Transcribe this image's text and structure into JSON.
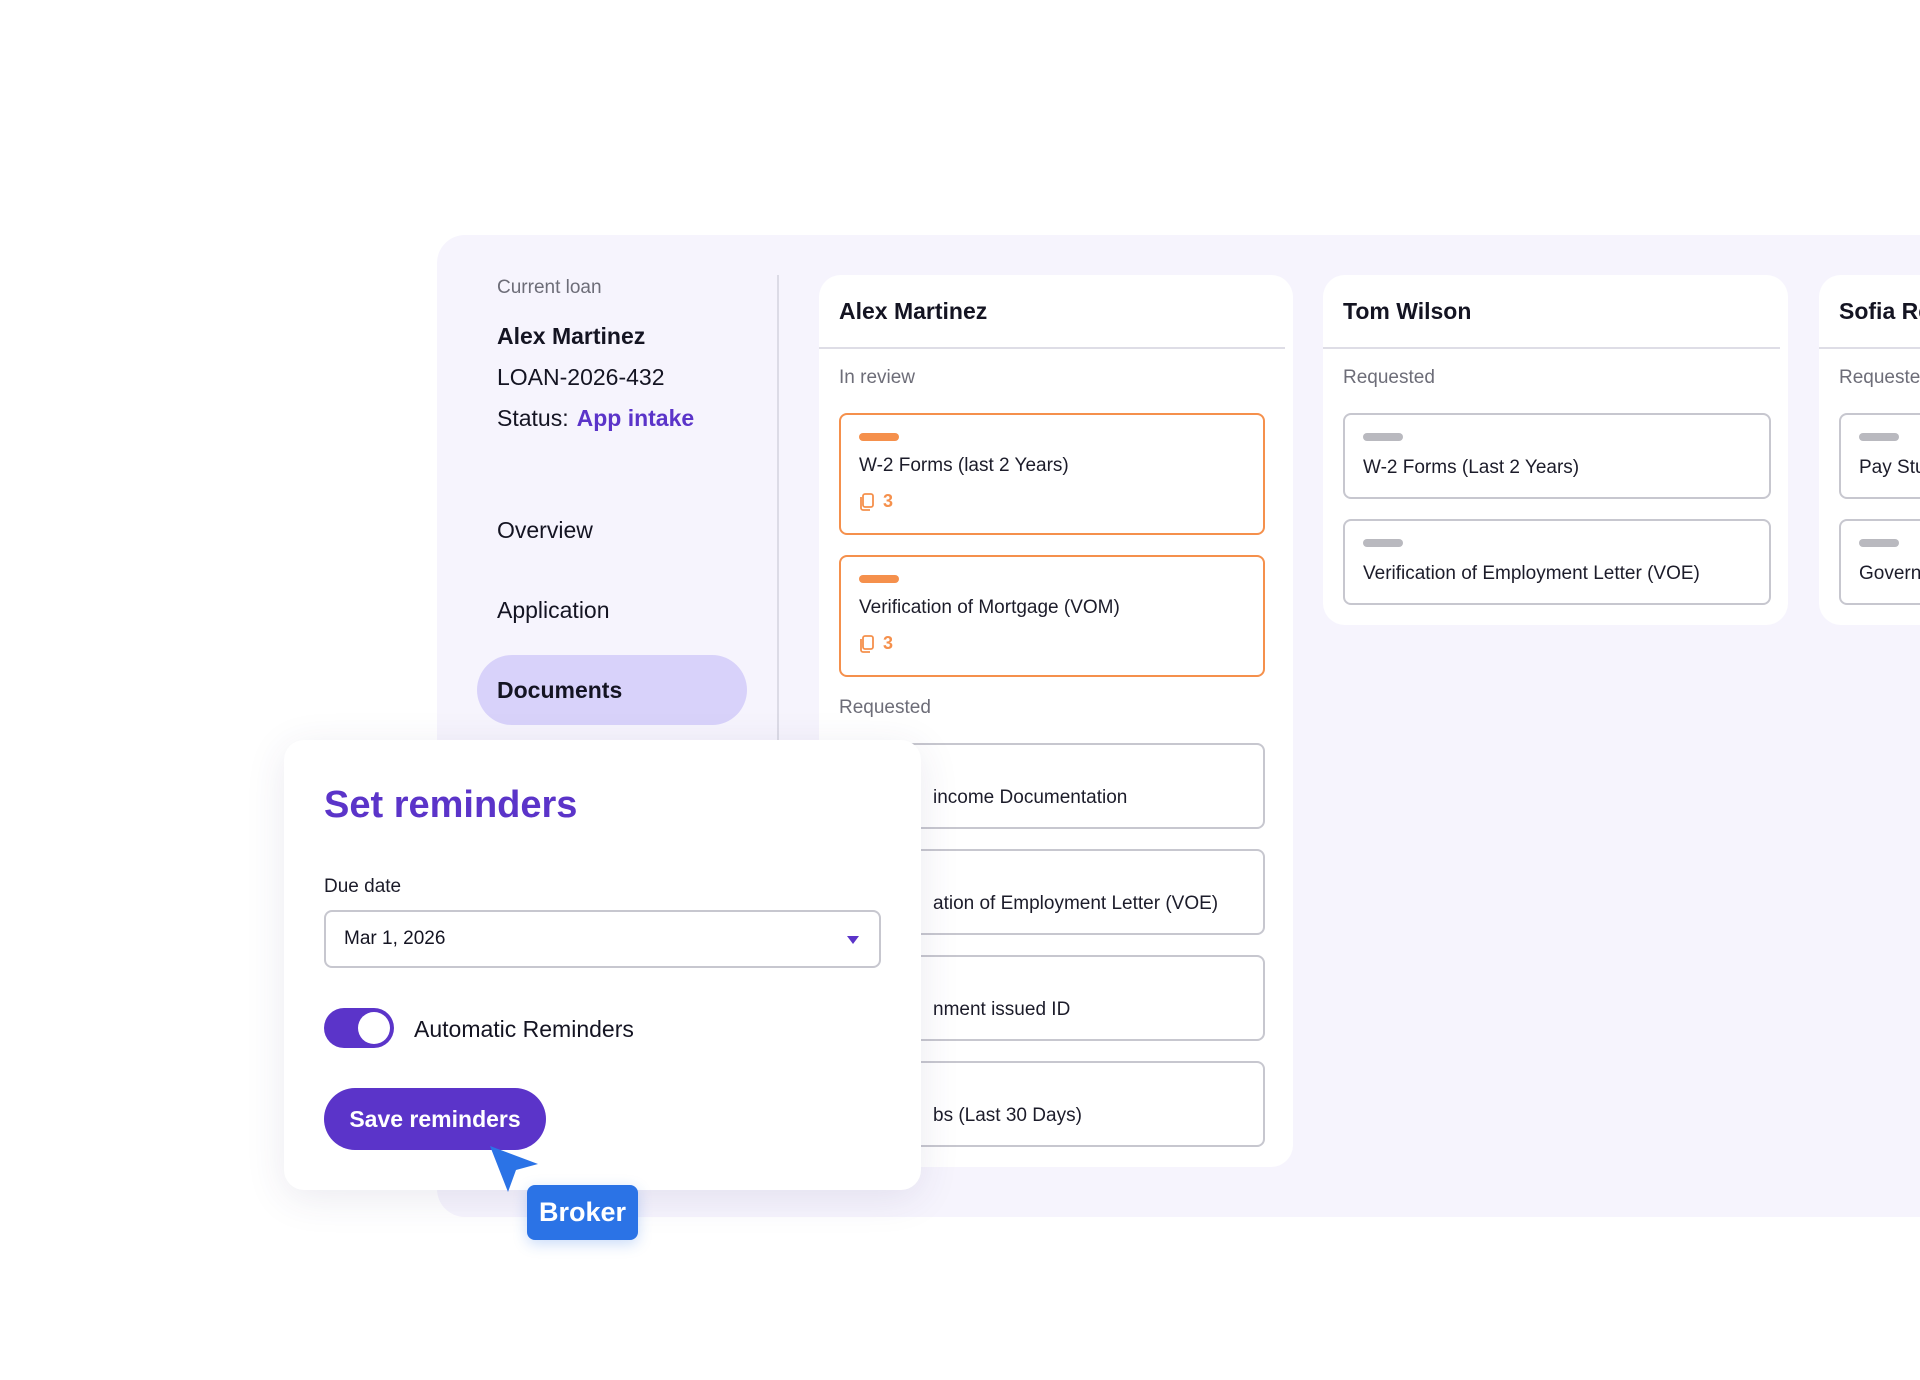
{
  "loan": {
    "current_loan_label": "Current loan",
    "borrower_name": "Alex Martinez",
    "loan_id": "LOAN-2026-432",
    "status_label": "Status:",
    "status_value": "App intake"
  },
  "nav": {
    "items": [
      {
        "label": "Overview"
      },
      {
        "label": "Application"
      },
      {
        "label": "Documents",
        "active": true
      }
    ]
  },
  "columns": [
    {
      "name": "Alex Martinez",
      "in_review_label": "In review",
      "in_review": [
        {
          "title": "W-2 Forms (last 2 Years)",
          "files": "3"
        },
        {
          "title": "Verification of Mortgage (VOM)",
          "files": "3"
        }
      ],
      "requested_label": "Requested",
      "requested": [
        {
          "title": "income Documentation"
        },
        {
          "title": "ation of Employment Letter (VOE)"
        },
        {
          "title": "nment issued ID"
        },
        {
          "title": "bs (Last 30 Days)"
        }
      ]
    },
    {
      "name": "Tom Wilson",
      "requested_label": "Requested",
      "requested": [
        {
          "title": "W-2 Forms (Last 2 Years)"
        },
        {
          "title": "Verification of Employment Letter (VOE)"
        }
      ]
    },
    {
      "name": "Sofia Re",
      "requested_label": "Requeste",
      "requested": [
        {
          "title": "Pay Stu"
        },
        {
          "title": "Govern"
        }
      ]
    }
  ],
  "reminders": {
    "title": "Set reminders",
    "due_date_label": "Due date",
    "due_date_value": "Mar 1, 2026",
    "auto_label": "Automatic Reminders",
    "auto_enabled": true,
    "save_label": "Save reminders"
  },
  "cursor_tag": "Broker",
  "colors": {
    "accent": "#5b34c9",
    "review_orange": "#f5904c",
    "panel_bg": "#f6f4fd",
    "nav_active_bg": "#d8d2fa",
    "cursor_blue": "#2b73e6"
  }
}
